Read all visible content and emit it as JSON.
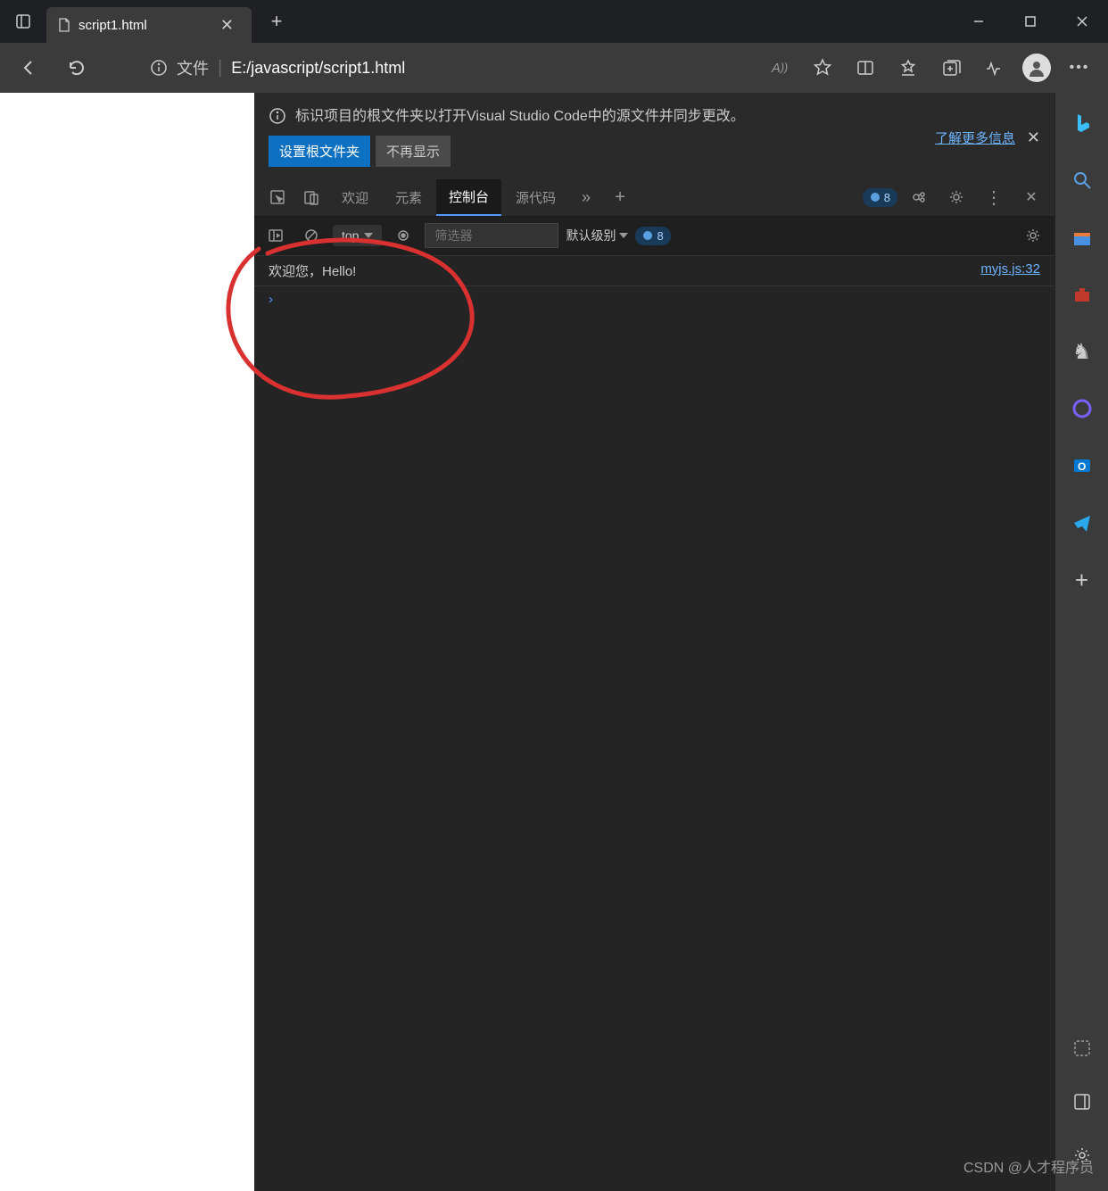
{
  "tab": {
    "title": "script1.html"
  },
  "address": {
    "prefix": "文件",
    "url": "E:/javascript/script1.html"
  },
  "devtools": {
    "info_text": "标识项目的根文件夹以打开Visual Studio Code中的源文件并同步更改。",
    "info_link": "了解更多信息",
    "btn_set_root": "设置根文件夹",
    "btn_dismiss": "不再显示",
    "tabs": {
      "welcome": "欢迎",
      "elements": "元素",
      "console": "控制台",
      "sources": "源代码"
    },
    "badge_count": "8",
    "console_toolbar": {
      "context": "top",
      "filter_placeholder": "筛选器",
      "level": "默认级别",
      "issues_count": "8"
    },
    "console": {
      "message": "欢迎您，Hello!",
      "source": "myjs.js:32"
    }
  },
  "watermark": "CSDN @人才程序员"
}
